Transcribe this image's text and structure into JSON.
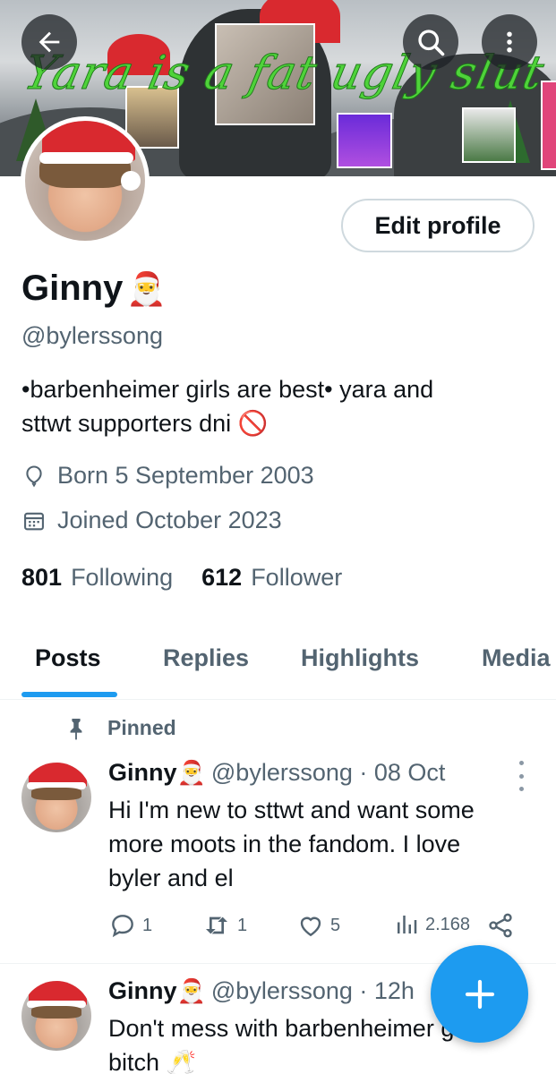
{
  "banner": {
    "overlay_text": "Yara is a fat ugly slut",
    "back_icon": "arrow-left-icon",
    "search_icon": "search-icon",
    "more_icon": "more-vertical-icon"
  },
  "profile": {
    "edit_button": "Edit profile",
    "name": "Ginny",
    "name_emoji": "🎅",
    "handle": "@bylerssong",
    "bio_line1": "•barbenheimer girls are best• yara and",
    "bio_line2": "sttwt supporters dni",
    "bio_emoji": "🚫",
    "born": "Born 5 September 2003",
    "joined": "Joined October 2023",
    "following_count": "801",
    "following_label": "Following",
    "follower_count": "612",
    "follower_label": "Follower"
  },
  "tabs": [
    {
      "label": "Posts",
      "active": true
    },
    {
      "label": "Replies",
      "active": false
    },
    {
      "label": "Highlights",
      "active": false
    },
    {
      "label": "Media",
      "active": false
    }
  ],
  "pinned_label": "Pinned",
  "posts": [
    {
      "name": "Ginny",
      "emoji": "🎅",
      "handle_time": "@bylerssong · 08 Oct",
      "text_lines": [
        "Hi I'm new to sttwt and want some",
        "more moots in the fandom. I love",
        "byler and el"
      ],
      "replies": "1",
      "reposts": "1",
      "likes": "5",
      "views": "2.168"
    },
    {
      "name": "Ginny",
      "emoji": "🎅",
      "handle_time": "@bylerssong · 12h",
      "text_lines": [
        "Don't mess with barbenheimer girls bitch 🥂"
      ]
    }
  ],
  "colors": {
    "accent": "#1d9bf0",
    "text_primary": "#0f1419",
    "text_secondary": "#536471",
    "banner_text": "#4fd33a"
  }
}
